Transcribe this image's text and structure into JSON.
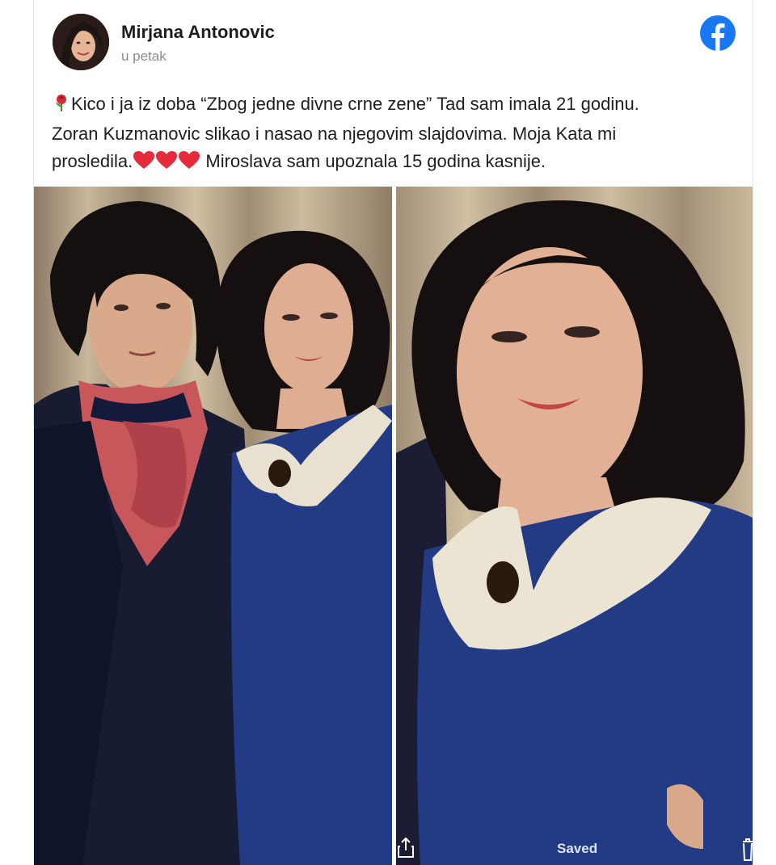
{
  "post": {
    "author": "Mirjana Antonovic",
    "timestamp": "u petak",
    "line1": "Kico i ja iz doba “Zbog jedne divne crne zene” Tad sam imala 21 godinu.",
    "line2": "Zoran Kuzmanovic slikao i nasao na njegovim slajdovima. Moja Kata mi",
    "line3_a": "prosledila.",
    "line3_b": " Miroslava sam upoznala 15 godina kasnije."
  },
  "icons": {
    "brand": "facebook-icon",
    "line_emoji": "rose-emoji",
    "hearts": [
      "red-heart-emoji",
      "red-heart-emoji",
      "red-heart-emoji"
    ],
    "share": "share-icon",
    "delete": "trash-icon"
  },
  "photo_viewer": {
    "saved_label": "Saved"
  },
  "colors": {
    "facebook_blue": "#1877f2",
    "text": "#1c1e21",
    "muted": "#8a8d91",
    "dress_blue": "#233a84"
  }
}
